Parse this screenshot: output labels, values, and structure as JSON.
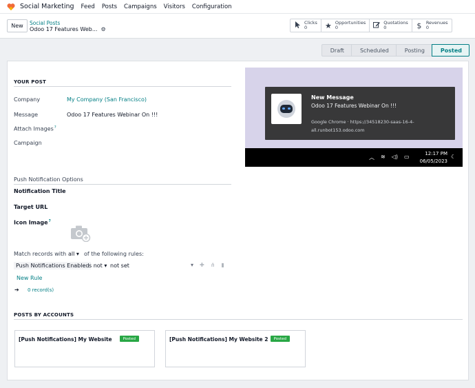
{
  "topbar": {
    "app_name": "Social Marketing",
    "menu": [
      "Feed",
      "Posts",
      "Campaigns",
      "Visitors",
      "Configuration"
    ]
  },
  "controlpanel": {
    "new_label": "New",
    "breadcrumb_parent": "Social Posts",
    "breadcrumb_current": "Odoo 17 Features Web...",
    "stats": [
      {
        "label": "Clicks",
        "value": "0",
        "icon": "cursor-icon"
      },
      {
        "label": "Opportunities",
        "value": "0",
        "icon": "star-icon"
      },
      {
        "label": "Quotations",
        "value": "0",
        "icon": "edit-icon"
      },
      {
        "label": "Revenues",
        "value": "0",
        "icon": "dollar-icon"
      }
    ]
  },
  "status": {
    "steps": [
      "Draft",
      "Scheduled",
      "Posting",
      "Posted"
    ],
    "active": "Posted"
  },
  "form": {
    "your_post_title": "YOUR POST",
    "company_label": "Company",
    "company_value": "My Company (San Francisco)",
    "message_label": "Message",
    "message_value": "Odoo 17 Features Webinar On !!!",
    "attach_label": "Attach Images",
    "attach_help": "?",
    "campaign_label": "Campaign",
    "push_title": "Push Notification Options",
    "notif_title_label": "Notification Title",
    "target_url_label": "Target URL",
    "icon_image_label": "Icon Image",
    "icon_help": "?",
    "match_prefix": "Match records with",
    "match_value": "all",
    "match_suffix": "of the following rules:",
    "rule_field": "Push Notifications Enabled",
    "rule_operator": "s not",
    "rule_value": "not set",
    "new_rule": "New Rule",
    "records": "0 record(s)",
    "posts_by_accounts_title": "POSTS BY ACCOUNTS"
  },
  "preview": {
    "title": "New Message",
    "body": "Odoo 17 Features Webinar On !!!",
    "source": "Google Chrome · https://34518230-saas-16-4-all.runbot153.odoo.com",
    "time": "12:17 PM",
    "date": "06/05/2023"
  },
  "cards": [
    {
      "title": "[Push Notifications] My Website",
      "badge": "Posted"
    },
    {
      "title": "[Push Notifications] My Website 2",
      "badge": "Posted"
    }
  ],
  "colors": {
    "accent": "#017e84",
    "badge_green": "#28a745",
    "preview_bg": "#d7d3ea",
    "notification_bg": "#383839"
  }
}
